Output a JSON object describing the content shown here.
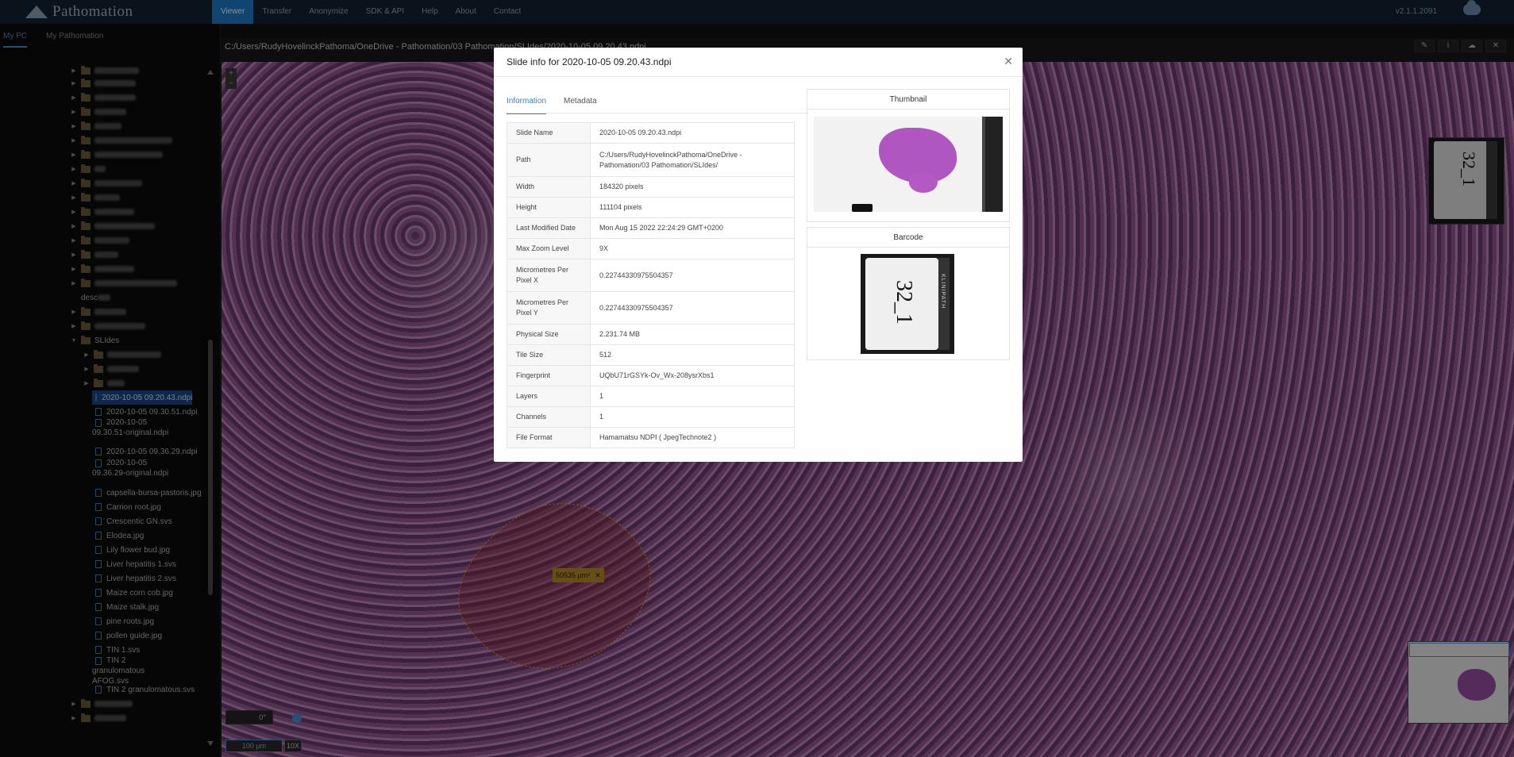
{
  "app": {
    "logo_text": "Pathomation",
    "version": "v2.1.1.2091",
    "nav": [
      "Viewer",
      "Transfer",
      "Anonymize",
      "SDK & API",
      "Help",
      "About",
      "Contact"
    ]
  },
  "sidebar": {
    "tabs": [
      "My PC",
      "My Pathomation"
    ],
    "folder_partial": "desc",
    "slides_folder": "SLIdes",
    "files": [
      "2020-10-05 09.20.43.ndpi",
      "2020-10-05 09.30.51.ndpi",
      "2020-10-05 09.30.51-original.ndpi",
      "2020-10-05 09.36.29.ndpi",
      "2020-10-05 09.36.29-original.ndpi",
      "capsella-bursa-pastoris.jpg",
      "Carrion root.jpg",
      "Crescentic GN.svs",
      "Elodea.jpg",
      "Lily flower bud.jpg",
      "Liver hepatitis 1.svs",
      "Liver hepatitis 2.svs",
      "Maize corn cob.jpg",
      "Maize stalk.jpg",
      "pine roots.jpg",
      "pollen guide.jpg",
      "TIN 1.svs",
      "TIN 2 granulomatous AFOG.svs",
      "TIN 2 granulomatous.svs"
    ]
  },
  "viewer": {
    "path": "C:/Users/RudyHovelinckPathoma/OneDrive - Pathomation/03 Pathomation/SLIdes/2020-10-05 09.20.43.ndpi",
    "annotation_area": "50535 µm²",
    "rotation_value": "0",
    "rotation_unit": "°",
    "scale_bar": "100 µm",
    "zoom": "10X",
    "label_text": "32_1"
  },
  "modal": {
    "title": "Slide info for 2020-10-05 09.20.43.ndpi",
    "tabs": [
      "Information",
      "Metadata"
    ],
    "rows": [
      {
        "key": "Slide Name",
        "value": "2020-10-05 09.20.43.ndpi"
      },
      {
        "key": "Path",
        "value": "C:/Users/RudyHovelinckPathoma/OneDrive - Pathomation/03 Pathomation/SLIdes/"
      },
      {
        "key": "Width",
        "value": "184320 pixels"
      },
      {
        "key": "Height",
        "value": "111104 pixels"
      },
      {
        "key": "Last Modified Date",
        "value": "Mon Aug 15 2022 22:24:29 GMT+0200"
      },
      {
        "key": "Max Zoom Level",
        "value": "9X"
      },
      {
        "key": "Micrometres Per Pixel X",
        "value": "0.22744330975504357"
      },
      {
        "key": "Micrometres Per Pixel Y",
        "value": "0.22744330975504357"
      },
      {
        "key": "Physical Size",
        "value": "2.231.74 MB"
      },
      {
        "key": "Tile Size",
        "value": "512"
      },
      {
        "key": "Fingerprint",
        "value": "UQbU71rGSYk-Ov_Wx-208ysrXbs1"
      },
      {
        "key": "Layers",
        "value": "1"
      },
      {
        "key": "Channels",
        "value": "1"
      },
      {
        "key": "File Format",
        "value": "Hamamatsu NDPI ( JpegTechnote2 )"
      }
    ],
    "thumbnail_heading": "Thumbnail",
    "barcode_heading": "Barcode",
    "barcode_strip_text": "KLINIPATH",
    "barcode_label_text": "32_1"
  }
}
